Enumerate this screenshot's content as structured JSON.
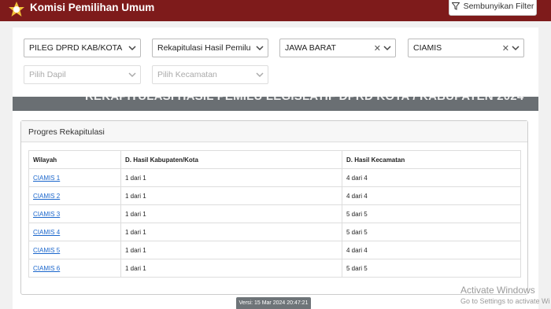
{
  "header": {
    "brand": "Komisi Pemilihan Umum",
    "hide_filter_label": "Sembunyikan Filter"
  },
  "filters": {
    "election": "PILEG DPRD KAB/KOTA",
    "report": "Rekapitulasi Hasil Pemilu",
    "province": "JAWA BARAT",
    "regency": "CIAMIS",
    "dapil_placeholder": "Pilih Dapil",
    "kecamatan_placeholder": "Pilih Kecamatan"
  },
  "banner_title": "REKAPITULASI HASIL PEMILU LEGISLATIF DPRD KOTA / KABUPATEN 2024",
  "progress": {
    "title": "Progres Rekapitulasi",
    "columns": [
      "Wilayah",
      "D. Hasil Kabupaten/Kota",
      "D. Hasil Kecamatan"
    ],
    "rows": [
      [
        "CIAMIS 1",
        "1 dari 1",
        "4 dari 4"
      ],
      [
        "CIAMIS 2",
        "1 dari 1",
        "4 dari 4"
      ],
      [
        "CIAMIS 3",
        "1 dari 1",
        "5 dari 5"
      ],
      [
        "CIAMIS 4",
        "1 dari 1",
        "5 dari 5"
      ],
      [
        "CIAMIS 5",
        "1 dari 1",
        "4 dari 4"
      ],
      [
        "CIAMIS 6",
        "1 dari 1",
        "5 dari 5"
      ]
    ]
  },
  "version": "Versi: 15 Mar 2024 20:47:21",
  "watermark": {
    "title": "Activate Windows",
    "subtitle": "Go to Settings to activate Wi"
  },
  "colors": {
    "header_bg": "#7e1b1b",
    "link": "#1a66cc",
    "banner_bg": "#6a6f73"
  },
  "icons": [
    "kpu-logo-icon",
    "filter-icon",
    "chevron-down-icon",
    "close-icon"
  ]
}
